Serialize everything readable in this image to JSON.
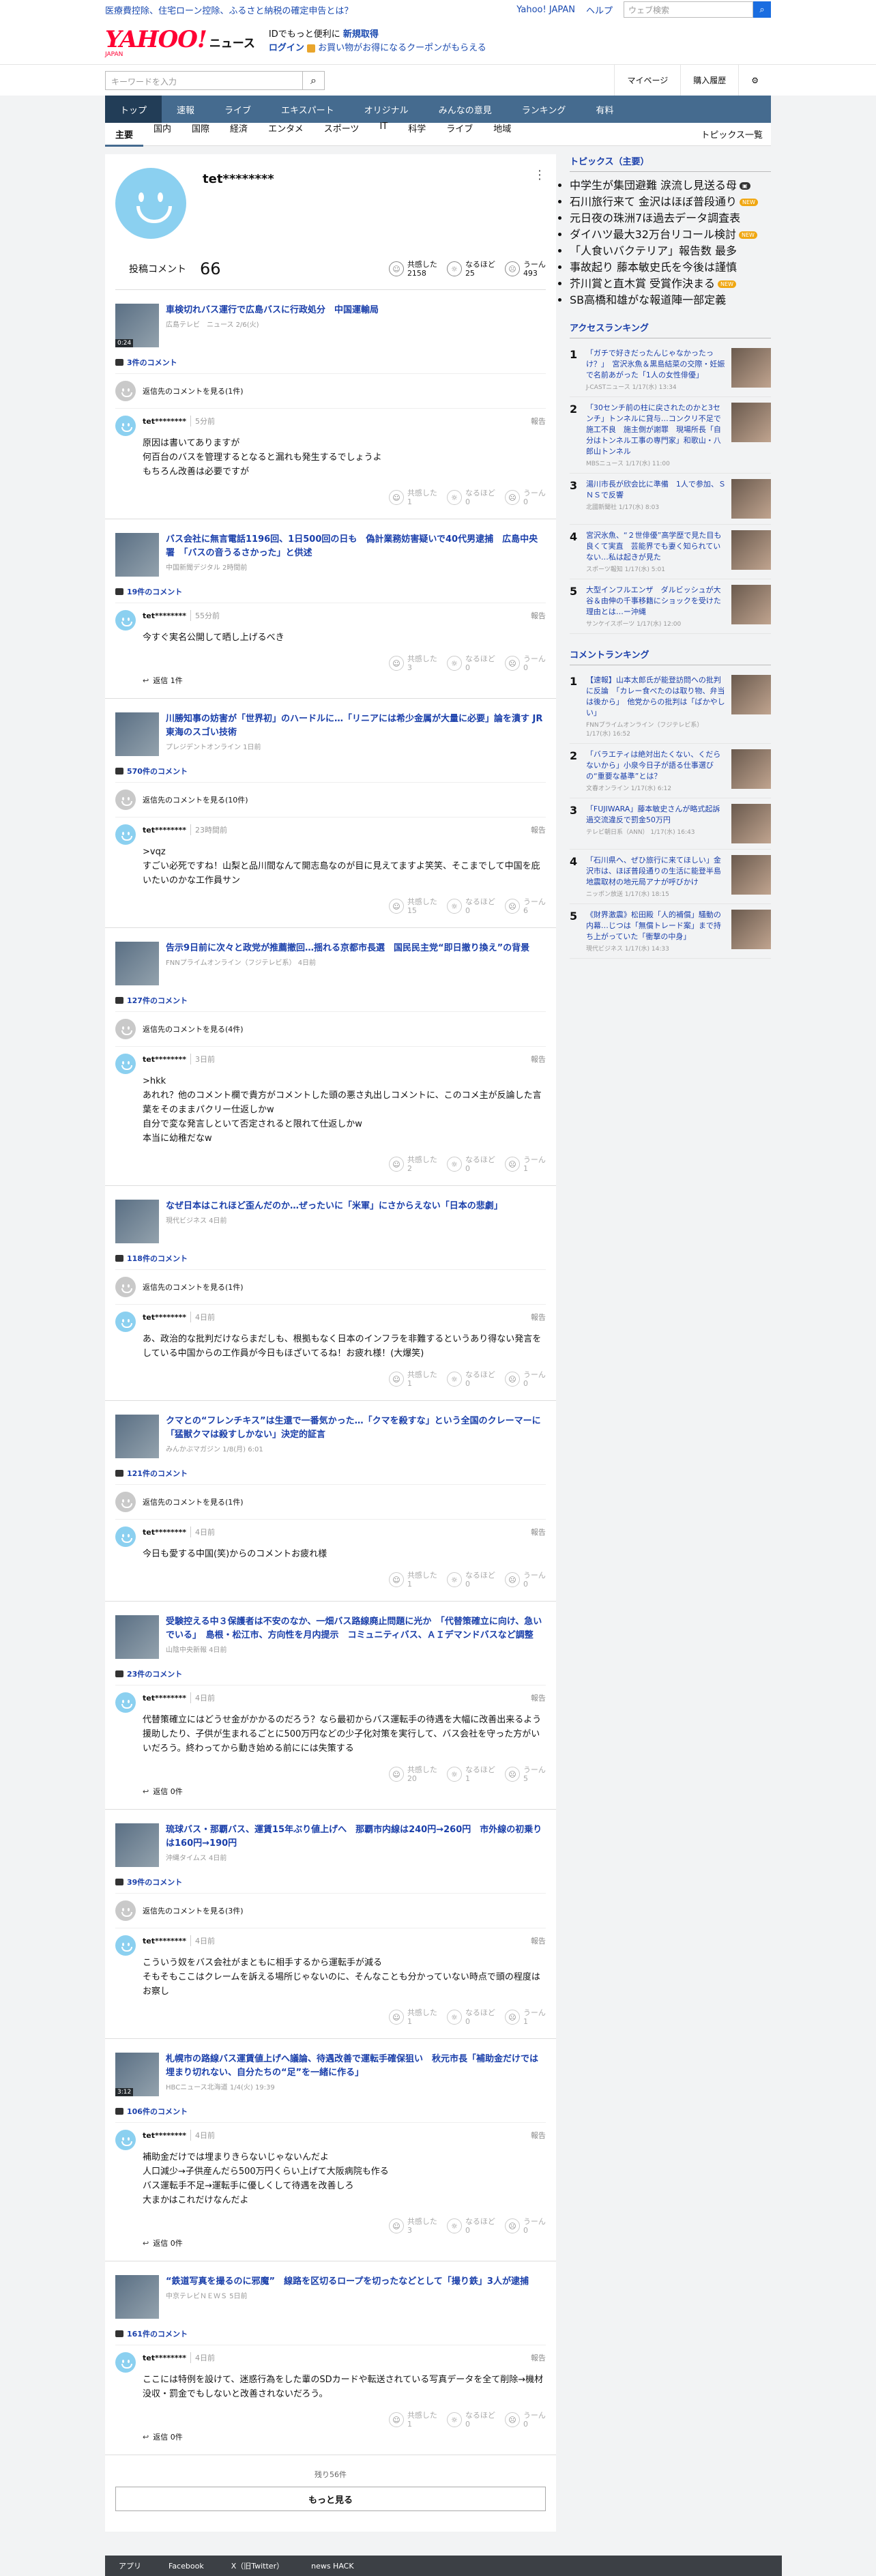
{
  "topbar": {
    "promo": "医療費控除、住宅ローン控除、ふるさと納税の確定申告とは？",
    "links": [
      "Yahoo! JAPAN",
      "ヘルプ"
    ],
    "search_placeholder": "ウェブ検索"
  },
  "header": {
    "logo": "YAHOO!",
    "logo_sub": "JAPAN",
    "logo_section": "ニュース",
    "promo_line1": "IDでもっと便利に",
    "promo_line1_link": "新規取得",
    "login": "ログイン",
    "promo_line2": "お買い物がお得になるクーポンがもらえる"
  },
  "subbar": {
    "search_placeholder": "キーワードを入力",
    "mypage": "マイページ",
    "purchase": "購入履歴"
  },
  "mainnav": [
    "トップ",
    "速報",
    "ライブ",
    "エキスパート",
    "オリジナル",
    "みんなの意見",
    "ランキング",
    "有料"
  ],
  "subnav": [
    "主要",
    "国内",
    "国際",
    "経済",
    "エンタメ",
    "スポーツ",
    "IT",
    "科学",
    "ライブ",
    "地域"
  ],
  "subnav_right": "トピックス一覧",
  "profile": {
    "name": "tet********",
    "comment_label": "投稿コメント",
    "comment_count": "66",
    "reactions": [
      {
        "label": "共感した",
        "count": "2158"
      },
      {
        "label": "なるほど",
        "count": "25"
      },
      {
        "label": "うーん",
        "count": "493"
      }
    ]
  },
  "reaction_labels": [
    "共感した",
    "なるほど",
    "うーん"
  ],
  "entries": [
    {
      "title": "車検切れバス運行で広島バスに行政処分　中国運輸局",
      "src": "広島テレビ　ニュース 2/6(火)",
      "dur": "0:24",
      "ccount": "3件のコメント",
      "parent": "返信先のコメントを見る(1件)",
      "user": "tet********",
      "time": "5分前",
      "report": "報告",
      "text": "原因は書いてありますが\n何百台のバスを管理するとなると漏れも発生するでしょうよ\nもちろん改善は必要ですが",
      "r": [
        "1",
        "0",
        "0"
      ],
      "reply": ""
    },
    {
      "title": "バス会社に無言電話1196回、1日500回の日も　偽計業務妨害疑いで40代男逮捕　広島中央署　「バスの音うるさかった」と供述",
      "src": "中国新聞デジタル 2時間前",
      "dur": "",
      "ccount": "19件のコメント",
      "parent": "",
      "user": "tet********",
      "time": "55分前",
      "report": "報告",
      "text": "今すぐ実名公開して晒し上げるべき",
      "r": [
        "3",
        "0",
        "0"
      ],
      "reply": "返信 1件"
    },
    {
      "title": "川勝知事の妨害が「世界初」のハードルに…「リニアには希少金属が大量に必要」論を潰す JR東海のスゴい技術",
      "src": "プレジデントオンライン 1日前",
      "dur": "",
      "ccount": "570件のコメント",
      "parent": "返信先のコメントを見る(10件)",
      "user": "tet********",
      "time": "23時間前",
      "report": "報告",
      "text": ">vqz\nすごい必死ですね！山梨と品川間なんて開志島なのが目に見えてますよ笑笑、そこまでして中国を庇いたいのかな工作員サン",
      "r": [
        "15",
        "0",
        "6"
      ],
      "reply": ""
    },
    {
      "title": "告示9日前に次々と政党が推薦撤回…揺れる京都市長選　国民民主党“即日撤り換え”の背景",
      "src": "FNNプライムオンライン（フジテレビ系） 4日前",
      "dur": "",
      "ccount": "127件のコメント",
      "parent": "返信先のコメントを見る(4件)",
      "user": "tet********",
      "time": "3日前",
      "report": "報告",
      "text": ">hkk\nあれれ？他のコメント欄で貴方がコメントした頭の悪さ丸出しコメントに、このコメ主が反論した言葉をそのままパクリー仕返しかw\n自分で変な発言しといて否定されると限れて仕返しかw\n本当に幼稚だなw",
      "r": [
        "2",
        "0",
        "1"
      ],
      "reply": ""
    },
    {
      "title": "なぜ日本はこれほど歪んだのか…ぜったいに「米軍」にさからえない「日本の悲劇」",
      "src": "現代ビジネス 4日前",
      "dur": "",
      "ccount": "118件のコメント",
      "parent": "返信先のコメントを見る(1件)",
      "user": "tet********",
      "time": "4日前",
      "report": "報告",
      "text": "あ、政治的な批判だけならまだしも、根拠もなく日本のインフラを非難するというあり得ない発言をしている中国からの工作員が今日もほざいてるね！お疲れ様！(大爆笑)",
      "r": [
        "1",
        "0",
        "0"
      ],
      "reply": ""
    },
    {
      "title": "クマとの“フレンチキス”は生還で一番気かった…「クマを殺すな」という全国のクレーマーに「猛獣クマは殺すしかない」決定的証言",
      "src": "みんかぶマガジン 1/8(月) 6:01",
      "dur": "",
      "ccount": "121件のコメント",
      "parent": "返信先のコメントを見る(1件)",
      "user": "tet********",
      "time": "4日前",
      "report": "報告",
      "text": "今日も愛する中国(笑)からのコメントお疲れ様",
      "r": [
        "1",
        "0",
        "0"
      ],
      "reply": ""
    },
    {
      "title": "受験控える中３保護者は不安のなか、一畑バス路線廃止問題に光か　「代替策確立に向け、急いでいる」　島根・松江市、方向性を月内提示　コミュニティバス、ＡＩデマンドバスなど調整",
      "src": "山陰中央新報 4日前",
      "dur": "",
      "ccount": "23件のコメント",
      "parent": "",
      "user": "tet********",
      "time": "4日前",
      "report": "報告",
      "text": "代替策確立にはどうせ金がかかるのだろう？なら最初からバス運転手の待遇を大幅に改善出来るよう援助したり、子供が生まれるごとに500万円などの少子化対策を実行して、バス会社を守った方がいいだろう。終わってから動き始める前にには失策する",
      "r": [
        "20",
        "1",
        "5"
      ],
      "reply": "返信 0件"
    },
    {
      "title": "琉球バス・那覇バス、運賃15年ぶり値上げへ　那覇市内線は240円→260円　市外線の初乗りは160円→190円",
      "src": "沖縄タイムス 4日前",
      "dur": "",
      "ccount": "39件のコメント",
      "parent": "返信先のコメントを見る(3件)",
      "user": "tet********",
      "time": "4日前",
      "report": "報告",
      "text": "こういう奴をバス会社がまともに相手するから運転手が減る\nそもそもここはクレームを訴える場所じゃないのに、そんなことも分かっていない時点で頭の程度はお察し",
      "r": [
        "1",
        "0",
        "1"
      ],
      "reply": ""
    },
    {
      "title": "札幌市の路線バス運賃値上げへ議論、待遇改善で運転手確保狙い　秋元市長「補助金だけでは埋まり切れない、自分たちの“足”を一緒に作る」",
      "src": "HBCニュース北海道 1/4(火) 19:39",
      "dur": "3:12",
      "ccount": "106件のコメント",
      "parent": "",
      "user": "tet********",
      "time": "4日前",
      "report": "報告",
      "text": "補助金だけでは埋まりきらないじゃないんだよ\n人口減少→子供産んだら500万円くらい上げて大阪病院も作る\nバス運転手不足→運転手に優しくして待遇を改善しろ\n大まかはこれだけなんだよ",
      "r": [
        "3",
        "0",
        "0"
      ],
      "reply": "返信 0件"
    },
    {
      "title": "“鉄道写真を撮るのに邪魔”　線路を区切るロープを切ったなどとして「撮り鉄」3人が逮捕",
      "src": "中京テレビＮＥＷＳ 5日前",
      "dur": "",
      "ccount": "161件のコメント",
      "parent": "",
      "user": "tet********",
      "time": "4日前",
      "report": "報告",
      "text": "ここには特例を設けて、迷惑行為をした輩のSDカードや転送されている写真データを全て削除→機材没収・罰金でもしないと改善されないだろう。",
      "r": [
        "1",
        "0",
        "0"
      ],
      "reply": "返信 0件"
    }
  ],
  "more": {
    "remain": "残り56件",
    "label": "もっと見る"
  },
  "topics": {
    "heading": "トピックス（主要）",
    "items": [
      {
        "text": "中学生が集団避難 涙流し見送る母",
        "badge": "img"
      },
      {
        "text": "石川旅行来て 金沢はほぼ普段通り",
        "badge": "new"
      },
      {
        "text": "元日夜の珠洲7ほ過去データ調査表",
        "badge": ""
      },
      {
        "text": "ダイハツ最大32万台リコール検討",
        "badge": "new"
      },
      {
        "text": "「人食いバクテリア」報告数 最多",
        "badge": ""
      },
      {
        "text": "事故起り 藤本敏史氏を今後は謹慎",
        "badge": ""
      },
      {
        "text": "芥川賞と直木賞 受賞作決まる",
        "badge": "new"
      },
      {
        "text": "SB高橋和雄がな報道陣一部定義",
        "badge": ""
      }
    ]
  },
  "access_ranking": {
    "heading": "アクセスランキング",
    "items": [
      {
        "no": "1",
        "title": "「ガチで好きだったんじゃなかったっけ？」　宮沢氷魚＆黒島結菜の交際・妊娠で名前あがった「1人の女性俳優」",
        "src": "J-CASTニュース 1/17(水) 13:34"
      },
      {
        "no": "2",
        "title": "「30センチ前の柱に戻されたのかと3センチ」トンネルに貸与…コンクリ不足で施工不良　施主側が謝罪　現場所長「自分はトンネル工事の専門家」和歌山・八郎山トンネル",
        "src": "MBSニュース 1/17(水) 11:00"
      },
      {
        "no": "3",
        "title": "湯川市長が欣会比に準備　1人で参加、ＳＮＳで反響",
        "src": "北國新聞社 1/17(水) 8:03"
      },
      {
        "no": "4",
        "title": "宮沢氷魚、“２世俳優”高学歴で見た目も良くて実直　芸能界でも妻く知られていない…私は起きが見た",
        "src": "スポーツ報知 1/17(水) 5:01"
      },
      {
        "no": "5",
        "title": "大型インフルエンザ　ダルビッシュが大谷＆由伸の千事移籍にショックを受けた理由とは…ー沖縄",
        "src": "サンケイスポーツ 1/17(水) 12:00"
      }
    ]
  },
  "comment_ranking": {
    "heading": "コメントランキング",
    "items": [
      {
        "no": "1",
        "title": "【速報】山本太郎氏が能登訪問への批判に反論　「カレー食べたのは取り物、弁当は後から」　他党からの批判は「ばかやしい」",
        "src": "FNNプライムオンライン（フジテレビ系） 1/17(水) 16:52"
      },
      {
        "no": "2",
        "title": "「バラエティは絶対出たくない、くだらないから」小泉今日子が語る仕事選びの“重要な基準”とは？",
        "src": "文春オンライン 1/17(水) 6:12"
      },
      {
        "no": "3",
        "title": "「FUJIWARA」藤本敏史さんが略式起訴　過交流違反で罰金50万円",
        "src": "テレビ朝日系（ANN） 1/17(水) 16:43"
      },
      {
        "no": "4",
        "title": "「石川県へ、ぜひ旅行に来てほしい」金沢市は、ほぼ普段通りの生活に能登半島地震取材の地元局アナが呼びかけ",
        "src": "ニッポン放送 1/17(水) 18:15"
      },
      {
        "no": "5",
        "title": "《財界激震》松田殿「人的補償」騒動の内幕…じつは「無償トレード案」まで持ち上がっていた「衝撃の中身」",
        "src": "現代ビジネス 1/17(水) 14:33"
      }
    ]
  },
  "footer": [
    "アプリ",
    "Facebook",
    "X（旧Twitter）",
    "news HACK"
  ]
}
